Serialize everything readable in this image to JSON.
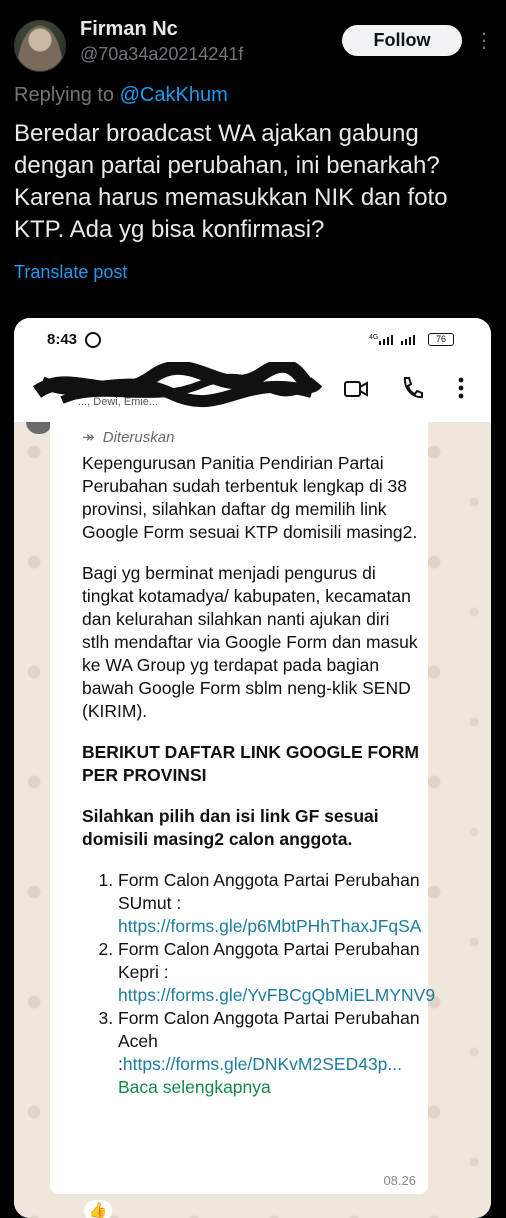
{
  "tweet": {
    "author_name": "Firman Nc",
    "author_handle": "@70a34a20214241f",
    "follow_label": "Follow",
    "replying_prefix": "Replying to",
    "replying_to": "@CakKhum",
    "text": "Beredar broadcast WA ajakan gabung dengan partai perubahan, ini benarkah? Karena harus memasukkan NIK dan foto KTP. Ada yg bisa konfirmasi?",
    "translate_label": "Translate post"
  },
  "screenshot": {
    "status_time": "8:43",
    "network": "4G",
    "battery": "76",
    "chat_participants": "..., Dewi, Emie...",
    "forward_label": "Diteruskan",
    "paragraph1": "Kepengurusan Panitia Pendirian Partai Perubahan sudah terbentuk lengkap di 38 provinsi, silahkan daftar dg memilih link Google Form sesuai KTP domisili masing2.",
    "paragraph2": "Bagi yg berminat menjadi pengurus di tingkat kotamadya/ kabupaten, kecamatan dan kelurahan silahkan nanti ajukan diri stlh mendaftar via Google Form dan masuk ke WA Group yg terdapat pada bagian bawah Google Form sblm neng-klik SEND (KIRIM).",
    "heading1": "BERIKUT DAFTAR LINK GOOGLE FORM PER PROVINSI",
    "heading2": "Silahkan pilih dan isi link GF sesuai domisili masing2 calon anggota.",
    "list": [
      {
        "text": "Form Calon Anggota Partai Perubahan SUmut : ",
        "link": "https://forms.gle/p6MbtPHhThaxJFqSA"
      },
      {
        "text": "Form Calon Anggota Partai Perubahan Kepri : ",
        "link": "https://forms.gle/YvFBCgQbMiELMYNV9"
      },
      {
        "text": "Form Calon Anggota Partai Perubahan Aceh :",
        "link": "https://forms.gle/DNKvM2SED43p..."
      }
    ],
    "read_more": "Baca selengkapnya",
    "timestamp": "08.26",
    "reaction": "👍"
  }
}
